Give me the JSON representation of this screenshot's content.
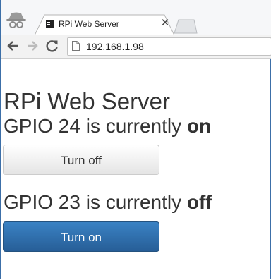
{
  "browser": {
    "tab": {
      "title": "RPi Web Server",
      "close_glyph": "✕"
    },
    "toolbar": {
      "url": "192.168.1.98"
    }
  },
  "page": {
    "heading": "RPi Web Server",
    "gpio": [
      {
        "prefix": "GPIO 24 is currently ",
        "state": "on",
        "button_label": "Turn off"
      },
      {
        "prefix": "GPIO 23 is currently ",
        "state": "off",
        "button_label": "Turn on"
      }
    ]
  },
  "colors": {
    "primary_button": "#2a6aaa",
    "window_border": "#3c6fa8"
  },
  "icons": [
    "incognito-icon",
    "terminal-favicon-icon",
    "close-icon",
    "new-tab-icon",
    "back-icon",
    "forward-icon",
    "reload-icon",
    "page-icon"
  ]
}
